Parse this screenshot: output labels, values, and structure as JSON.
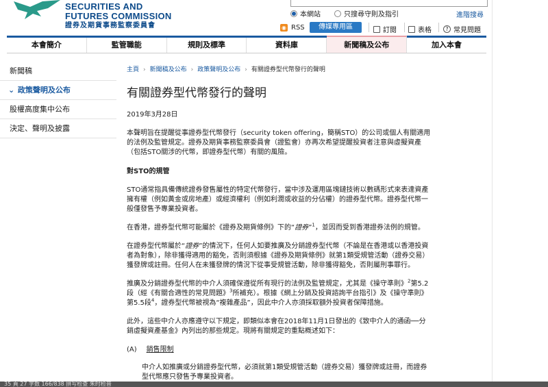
{
  "header": {
    "org_line1": "SECURITIES AND",
    "org_line2": "FUTURES COMMISSION",
    "org_line3": "證券及期貨事務監察委員會",
    "search": {
      "site_label": "本網站",
      "rules_label": "只搜尋守則及指引",
      "advanced": "進階搜尋"
    },
    "rss": "RSS",
    "media": "傳媒專用區",
    "subscribe": "訂閱",
    "forms": "表格",
    "faq": "常見問題"
  },
  "nav": [
    "本會簡介",
    "監管職能",
    "規則及標準",
    "資料庫",
    "新聞稿及公布",
    "加入本會"
  ],
  "nav_active_index": 4,
  "sidebar": [
    {
      "label": "新聞稿",
      "current": false
    },
    {
      "label": "政策聲明及公布",
      "current": true
    },
    {
      "label": "股權高度集中公布",
      "current": false
    },
    {
      "label": "決定、聲明及披露",
      "current": false
    }
  ],
  "breadcrumb": [
    "主頁",
    "新聞稿及公布",
    "政策聲明及公布",
    "有關證券型代幣發行的聲明"
  ],
  "article": {
    "title": "有關證券型代幣發行的聲明",
    "date": "2019年3月28日",
    "p1": "本聲明旨在提醒從事證券型代幣發行（security token offering，簡稱STO）的公司或個人有關適用的法例及監管規定。證券及期貨事務監察委員會（證監會）亦再次希望提醒投資者注意與虛擬資產（包括STO關涉的代幣，即證券型代幣）有關的風險。",
    "h_sto": "對STO的規管",
    "p2": "STO通常指具備傳統證券發售屬性的特定代幣發行，當中涉及運用區塊鏈技術以數碼形式來表達資產擁有權（例如黃金或房地產）或經濟權利（例如利潤或收益的分佔權）的證券型代幣。證券型代幣一般僅發售予專業投資者。",
    "p3a": "在香港，證券型代幣可能屬於《證券及期貨條例》下的“",
    "p3em": "證券",
    "p3b": "”",
    "p3sup": "1",
    "p3c": "，並因而受到香港證券法例的規管。",
    "p4a": "在證券型代幣屬於“",
    "p4em": "證券",
    "p4b": "”的情況下，任何人如要推廣及分銷證券型代幣（不論是在香港或以香港投資者為對象），除非獲得適用的豁免，否則須根據《證券及期貨條例》就第1類受規管活動（證券交易）獲發牌或註冊。任何人在未獲發牌的情況下從事受規管活動，除非獲得豁免，否則屬刑事罪行。",
    "p5a": "推廣及分銷證券型代幣的中介人須確保遵從所有現行的法例及監管規定，尤其是《操守準則》",
    "p5sup1": "2",
    "p5b": "第5.2段（經《有關合適性的常見問題》",
    "p5sup2": "3",
    "p5c": "所補充）。根據《網上分銷及投資諮詢平台指引》及《操守準則》第5.5段",
    "p5sup3": "4",
    "p5d": "，證券型代幣被視為“複雜產品”，因此中介人亦須採取額外投資者保障措施。",
    "p6": "此外，這些中介人亦應遵守以下規定，即類似本會在2018年11月1日發出的《致中介人的通函──分銷虛擬資產基金》內列出的那些規定。現將有關規定的重點概述如下：",
    "a_label": "(A)",
    "a_title": "銷售限制",
    "a_text": "中介人如推廣或分銷證券型代幣，必須就第1類受規管活動（證券交易）獲發牌或註冊，而證券型代幣應只發售予專業投資者。"
  },
  "statusbar": "35   頁 27   字数 166/838    拼写检查    朱时检音"
}
